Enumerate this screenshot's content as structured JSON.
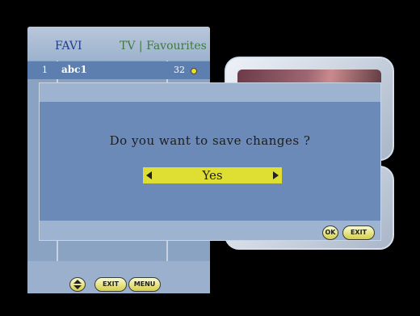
{
  "list": {
    "header_left": "FAVI",
    "header_right": "TV | Favourites",
    "rows": [
      {
        "number": "1",
        "name": "abc1",
        "lcn": "32"
      }
    ]
  },
  "dialog": {
    "message": "Do you want to save changes ?",
    "selected_option": "Yes"
  },
  "buttons": {
    "ok": "OK",
    "exit": "EXIT",
    "menu": "MENU"
  },
  "colors": {
    "panel_blue": "#6b8ab7",
    "selector_yellow": "#dede33",
    "header_text_blue": "#1f3d8a",
    "header_text_green": "#3e7a3e"
  },
  "icons": {
    "selector_left": "triangle-left-icon",
    "selector_right": "triangle-right-icon",
    "favourite_marker": "dot-icon",
    "navigate": "up-down-icon"
  }
}
